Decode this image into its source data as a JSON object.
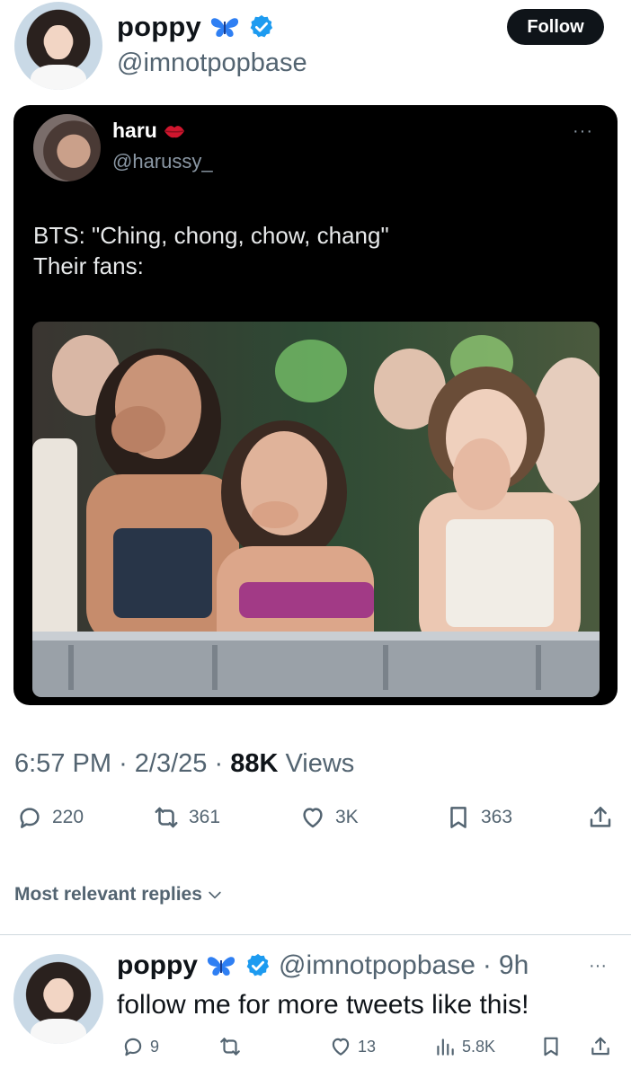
{
  "author": {
    "name": "poppy",
    "handle": "@imnotpopbase",
    "follow_label": "Follow",
    "verified": true,
    "emoji": "butterfly-icon"
  },
  "quoted": {
    "name": "haru",
    "emoji": "kiss-lips-icon",
    "handle": "@harussy_",
    "text": "BTS: \"Ching, chong, chow, chang\"\nTheir fans:",
    "more_label": "···",
    "image": "photo of crying concert fans covering their mouths"
  },
  "meta": {
    "time": "6:57 PM",
    "date": "2/3/25",
    "views_count": "88K",
    "views_label": "Views"
  },
  "actions": {
    "replies": "220",
    "reposts": "361",
    "likes": "3K",
    "bookmarks": "363"
  },
  "replies_header": "Most relevant replies",
  "reply": {
    "name": "poppy",
    "handle": "@imnotpopbase",
    "age": "9h",
    "text": "follow me for more tweets like this!",
    "more_label": "···",
    "replies": "9",
    "reposts": "",
    "likes": "13",
    "views": "5.8K"
  },
  "colors": {
    "text": "#0f1419",
    "secondary": "#536471",
    "verified_blue": "#1d9bf0",
    "card_bg": "#000000"
  }
}
